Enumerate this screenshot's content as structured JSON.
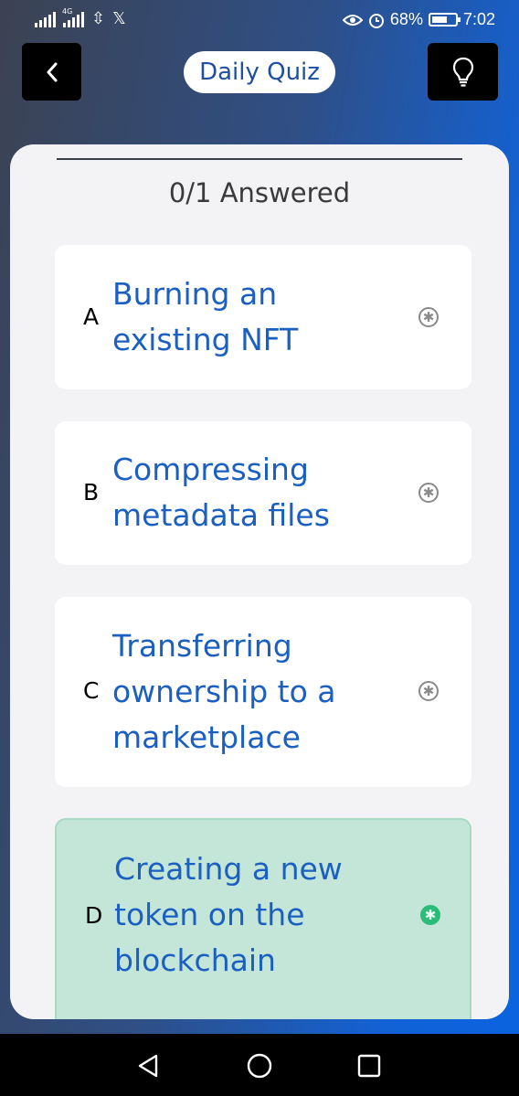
{
  "status_bar": {
    "network_label": "4G",
    "battery_percent": "68%",
    "battery_level": 0.68,
    "time": "7:02"
  },
  "header": {
    "title": "Daily Quiz",
    "back_icon": "chevron-left-icon",
    "hint_icon": "lightbulb-icon"
  },
  "quiz": {
    "progress": "0/1 Answered",
    "options": [
      {
        "letter": "A",
        "lines": [
          "Burning an",
          "existing NFT"
        ],
        "selected": false
      },
      {
        "letter": "B",
        "lines": [
          "Compressing",
          "metadata files"
        ],
        "selected": false
      },
      {
        "letter": "C",
        "lines": [
          "Transferring",
          "ownership to a",
          "marketplace"
        ],
        "selected": false
      },
      {
        "letter": "D",
        "lines": [
          "Creating a new",
          "token on the",
          "blockchain"
        ],
        "selected": true
      }
    ]
  },
  "colors": {
    "accent_text": "#1b5fc1",
    "selected_bg": "#c3e6d9",
    "selected_radio": "#2dbb7a"
  },
  "nav_bar": {
    "icons": [
      "back-triangle-icon",
      "home-circle-icon",
      "recents-square-icon"
    ]
  }
}
